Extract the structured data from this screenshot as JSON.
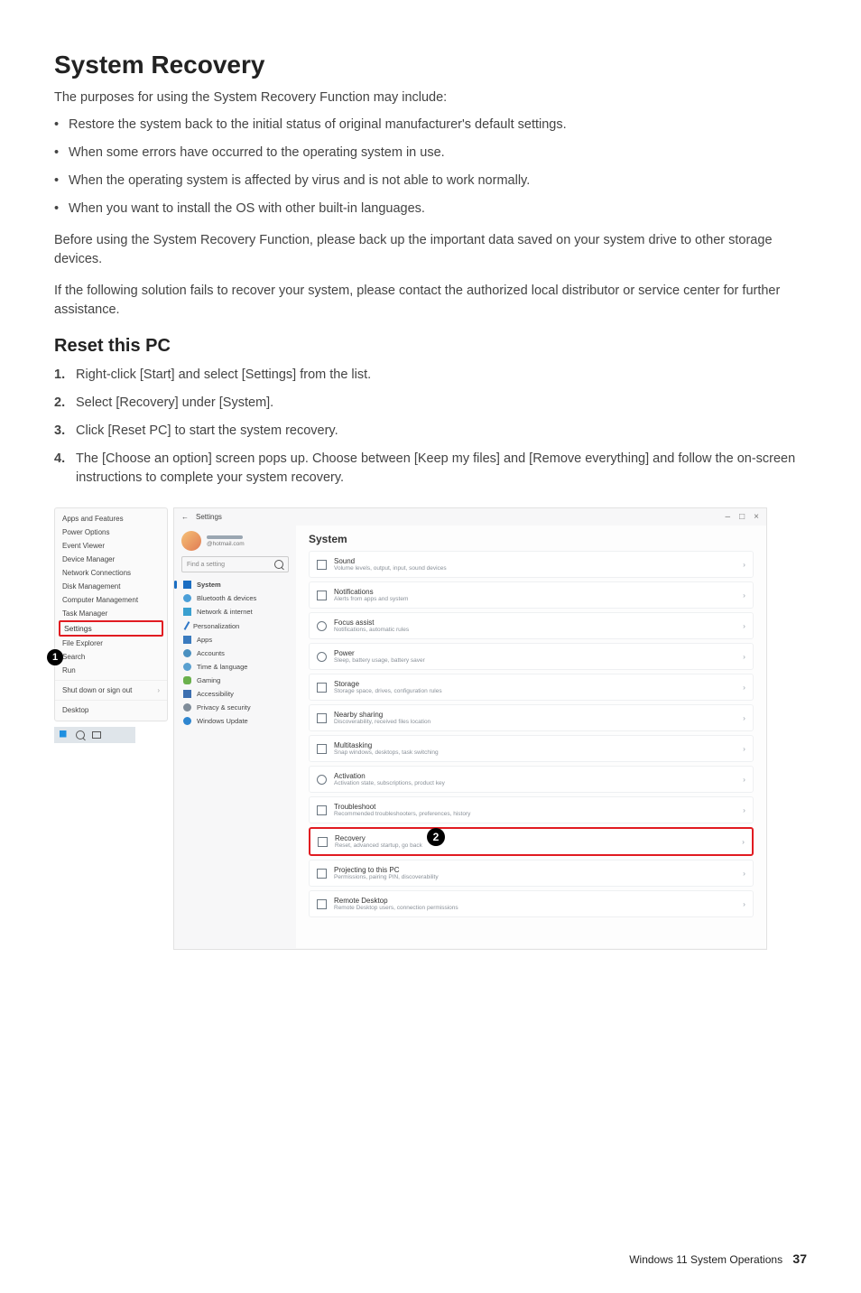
{
  "page": {
    "heading": "System Recovery",
    "intro": "The purposes for using the System Recovery Function may include:",
    "bullets": [
      "Restore the system back to the initial status of original manufacturer's default settings.",
      "When some errors have occurred to the operating system in use.",
      "When the operating system is affected by virus and is not able to work normally.",
      "When you want to install the OS with other built-in languages."
    ],
    "para1": "Before using the System Recovery Function, please back up the important data saved on your system drive to other storage devices.",
    "para2": "If the following solution fails to recover your system, please contact the authorized local distributor or service center for further assistance.",
    "sub_heading": "Reset this PC",
    "steps": [
      "Right-click [Start] and select [Settings] from the list.",
      "Select [Recovery] under [System].",
      "Click [Reset PC] to start the system recovery.",
      "The [Choose an option] screen pops up. Choose between [Keep my files] and [Remove everything] and follow the on-screen instructions to complete your system recovery."
    ]
  },
  "context_menu": {
    "items_top": [
      "Apps and Features",
      "Power Options",
      "Event Viewer",
      "Device Manager",
      "Network Connections",
      "Disk Management",
      "Computer Management",
      "Task Manager"
    ],
    "highlight": "Settings",
    "items_mid": [
      "File Explorer",
      "Search",
      "Run"
    ],
    "items_bottom": [
      "Shut down or sign out",
      "Desktop"
    ]
  },
  "callouts": {
    "one": "1",
    "two": "2"
  },
  "settings_window": {
    "back": "←",
    "title": "Settings",
    "win_min": "–",
    "win_max": "□",
    "win_close": "×",
    "user_mail": "@hotmail.com",
    "search_placeholder": "Find a setting",
    "nav": [
      "System",
      "Bluetooth & devices",
      "Network & internet",
      "Personalization",
      "Apps",
      "Accounts",
      "Time & language",
      "Gaming",
      "Accessibility",
      "Privacy & security",
      "Windows Update"
    ],
    "panel_heading": "System",
    "rows": [
      {
        "t": "Sound",
        "d": "Volume levels, output, input, sound devices"
      },
      {
        "t": "Notifications",
        "d": "Alerts from apps and system"
      },
      {
        "t": "Focus assist",
        "d": "Notifications, automatic rules"
      },
      {
        "t": "Power",
        "d": "Sleep, battery usage, battery saver"
      },
      {
        "t": "Storage",
        "d": "Storage space, drives, configuration rules"
      },
      {
        "t": "Nearby sharing",
        "d": "Discoverability, received files location"
      },
      {
        "t": "Multitasking",
        "d": "Snap windows, desktops, task switching"
      },
      {
        "t": "Activation",
        "d": "Activation state, subscriptions, product key"
      },
      {
        "t": "Troubleshoot",
        "d": "Recommended troubleshooters, preferences, history"
      },
      {
        "t": "Recovery",
        "d": "Reset, advanced startup, go back"
      },
      {
        "t": "Projecting to this PC",
        "d": "Permissions, pairing PIN, discoverability"
      },
      {
        "t": "Remote Desktop",
        "d": "Remote Desktop users, connection permissions"
      }
    ]
  },
  "footer": {
    "label": "Windows 11 System Operations",
    "page": "37"
  }
}
